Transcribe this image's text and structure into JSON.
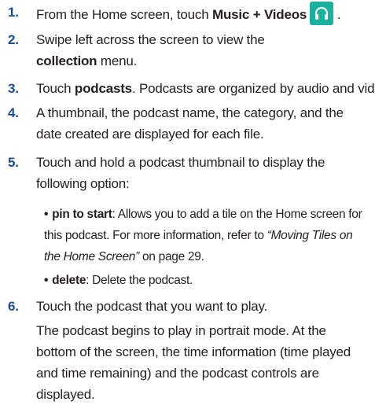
{
  "steps": [
    {
      "num": "1.",
      "pre": "From the Home screen, touch ",
      "bold": "Music + Videos",
      "post": " ."
    },
    {
      "num": "2.",
      "line1": "Swipe left across the screen to view the",
      "bold": "collection",
      "post": " menu."
    },
    {
      "num": "3.",
      "pre": "Touch ",
      "bold": "podcasts",
      "post": ". Podcasts are organized by audio and video."
    },
    {
      "num": "4.",
      "line1": "A thumbnail, the podcast name, the category, and the",
      "line2": "date created are displayed for each file."
    },
    {
      "num": "5.",
      "line1": "Touch and hold a podcast thumbnail to display the",
      "line2": "following option:"
    },
    {
      "num": "6.",
      "line1": "Touch the podcast that you want to play.",
      "para1": "The podcast begins to play in portrait mode. At the",
      "para2": "bottom of the screen, the time information (time played",
      "para3": "and time remaining) and the podcast controls are",
      "para4": "displayed."
    }
  ],
  "options": [
    {
      "bullet": "•",
      "bold": "pin to start",
      "text1": ": Allows you to add a tile on the Home screen for",
      "text2": "this podcast. For more information, refer to ",
      "xref_a": "“Moving Tiles on",
      "xref_b": "the Home Screen”",
      "page_ref": "  on page 29."
    },
    {
      "bullet": "•",
      "bold": "delete",
      "text1": ": Delete the podcast."
    }
  ],
  "icons": {
    "music_videos": "headphones-icon"
  },
  "colors": {
    "step_number": "#1a4c9c",
    "icon_bg": "#1ab19f"
  }
}
